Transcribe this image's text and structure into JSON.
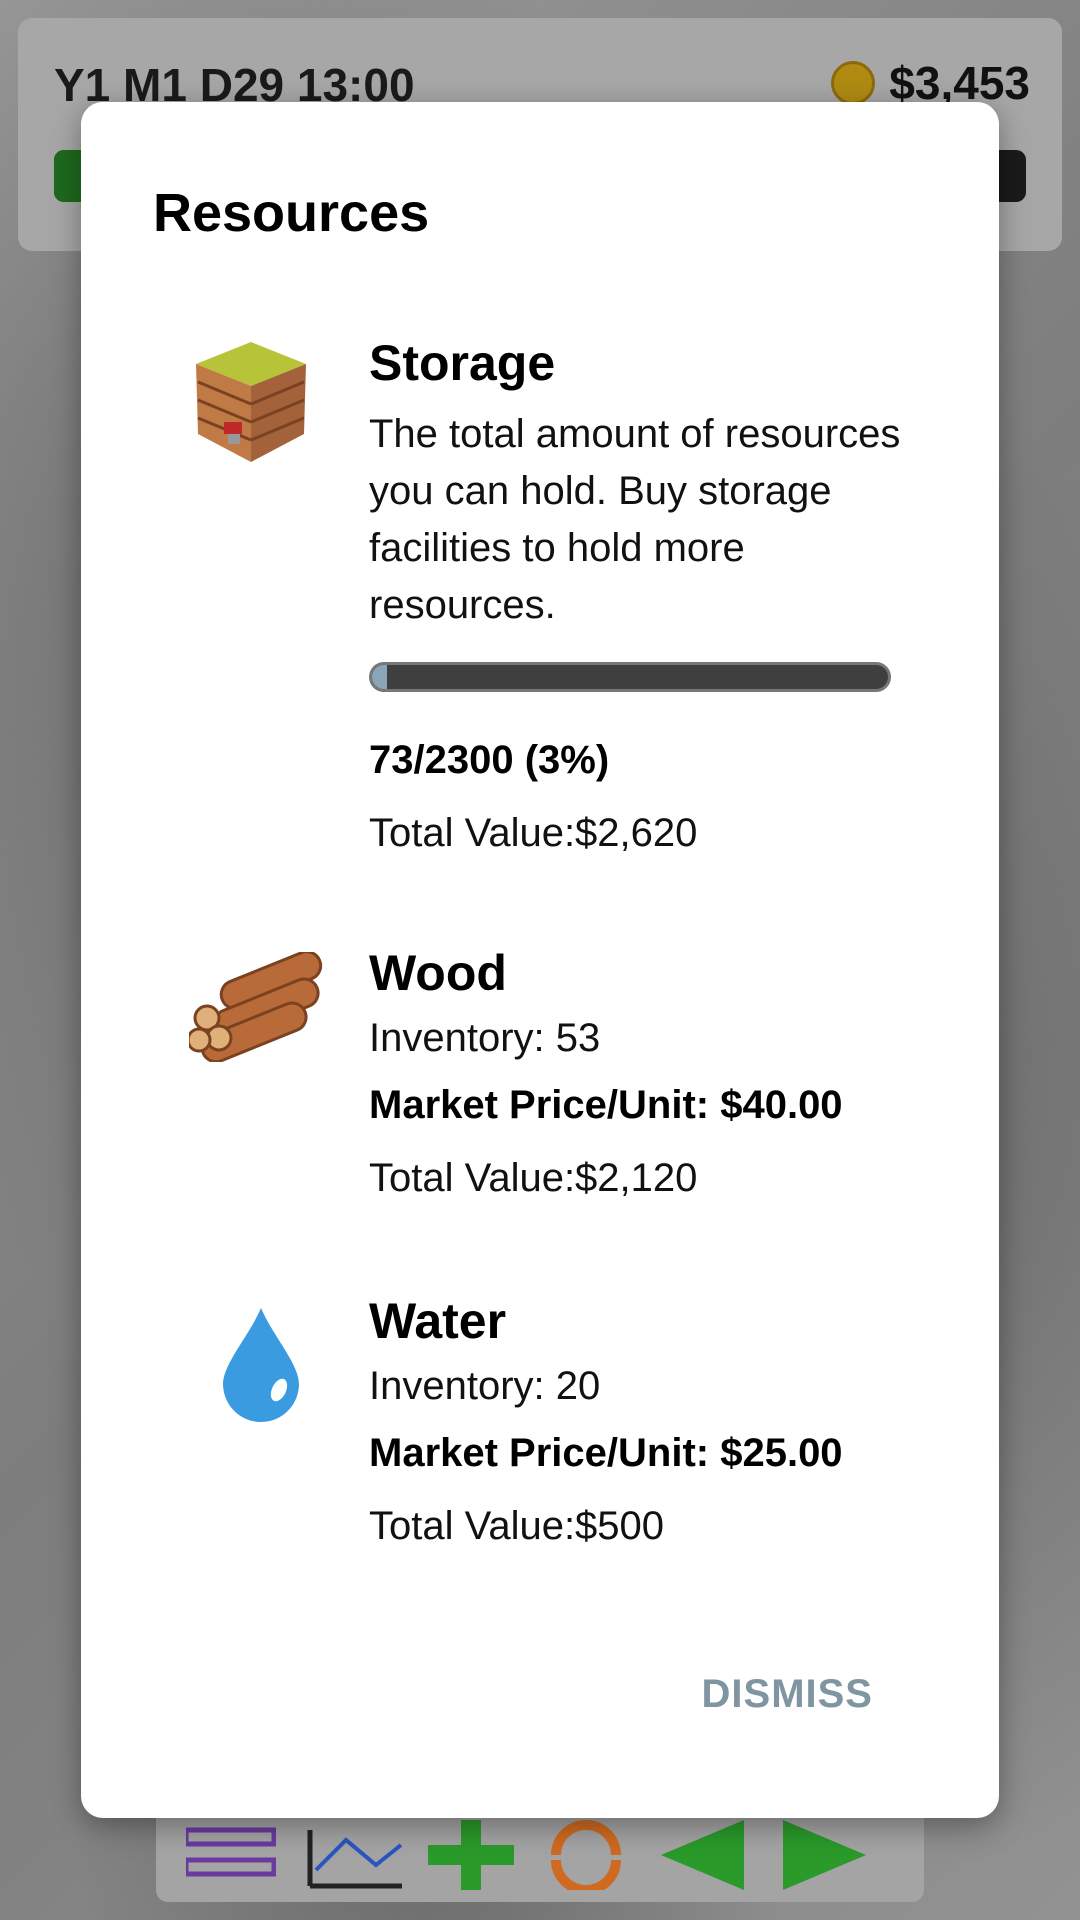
{
  "hud": {
    "date": "Y1 M1 D29 13:00",
    "money": "$3,453",
    "time_progress": 0.06
  },
  "dialog": {
    "title": "Resources",
    "storage": {
      "name": "Storage",
      "description": "The total amount of resources you can hold. Buy storage facilities to hold more resources.",
      "usage_text": "73/2300 (3%)",
      "usage_fraction": 0.03,
      "total_value": "Total Value:$2,620",
      "icon": "storage-hut-icon"
    },
    "wood": {
      "name": "Wood",
      "inventory": "Inventory: 53",
      "market_price": "Market Price/Unit: $40.00",
      "total_value": "Total Value:$2,120",
      "icon": "wood-logs-icon"
    },
    "water": {
      "name": "Water",
      "inventory": "Inventory: 20",
      "market_price": "Market Price/Unit: $25.00",
      "total_value": "Total Value:$500",
      "icon": "water-drop-icon"
    },
    "dismiss_label": "DISMISS"
  },
  "colors": {
    "dismiss": "#7f95a1",
    "progress_track": "#3f3f3f",
    "progress_fill": "#8aa4b8",
    "water_drop": "#3a9be0"
  }
}
